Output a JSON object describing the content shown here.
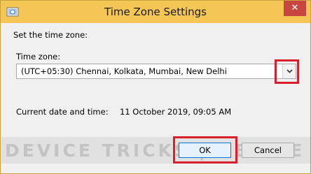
{
  "window": {
    "title": "Time Zone Settings",
    "close_glyph": "✕"
  },
  "body": {
    "instruction": "Set the time zone:",
    "timezone_label": "Time zone:",
    "timezone_value": "(UTC+05:30) Chennai, Kolkata, Mumbai, New Delhi",
    "current_label": "Current date and time:",
    "current_value": "11 October 2019, 09:05 AM"
  },
  "buttons": {
    "ok": "OK",
    "cancel": "Cancel"
  },
  "watermark": {
    "text": "DEVICE TRICKS | DEVICE TR"
  },
  "colors": {
    "titlebar": "#f3c655",
    "close": "#c7463f",
    "highlight": "#d8202a",
    "default_button_border": "#0078d7"
  },
  "icons": {
    "app": "timezone-app-icon",
    "close": "close-icon",
    "dropdown": "chevron-down-icon"
  }
}
